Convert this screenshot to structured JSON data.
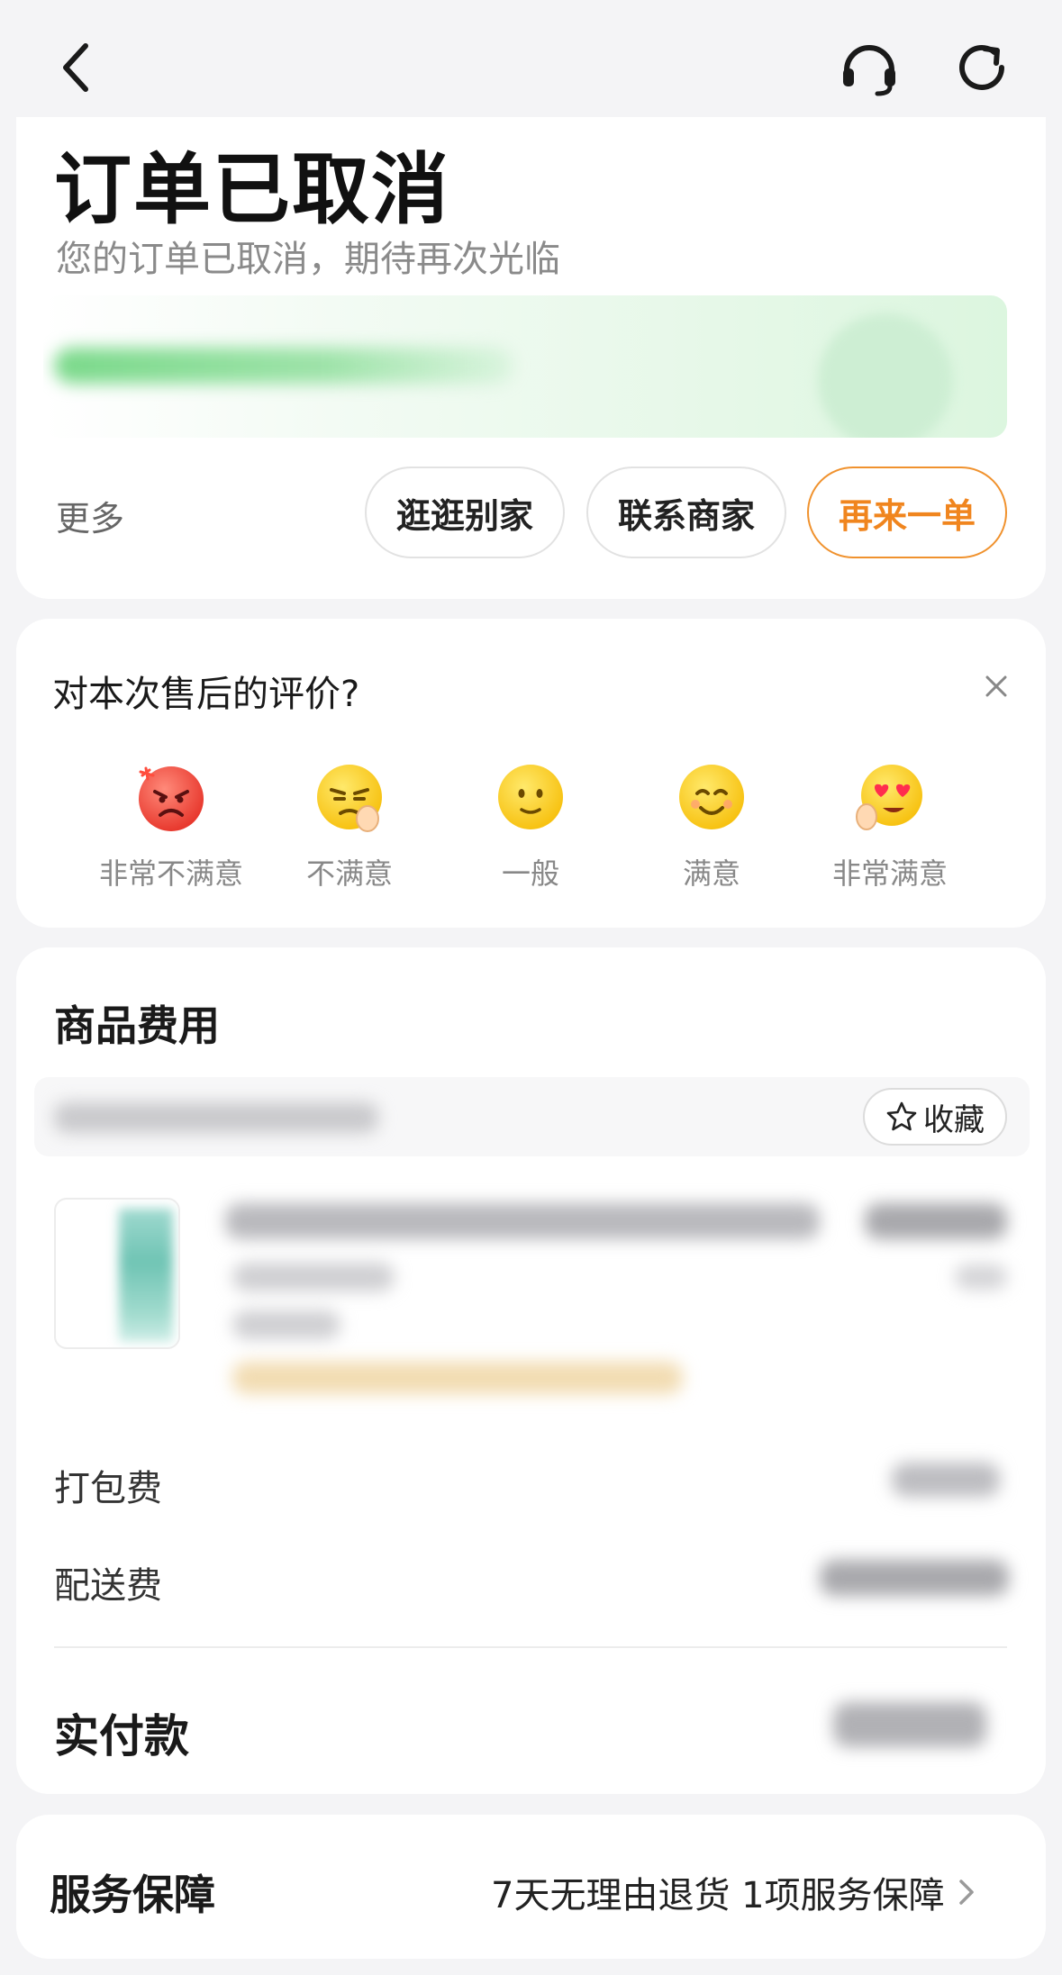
{
  "header": {
    "back_icon": "chevron-left-icon",
    "service_icon": "headset-icon",
    "refresh_icon": "refresh-icon"
  },
  "status": {
    "title": "订单已取消",
    "subtitle": "您的订单已取消，期待再次光临",
    "more_label": "更多",
    "actions": {
      "browse_other": "逛逛别家",
      "contact_merchant": "联系商家",
      "order_again": "再来一单"
    },
    "accent_color": "#f0851e"
  },
  "rating": {
    "question": "对本次售后的评价?",
    "options": [
      {
        "label": "非常不满意",
        "icon": "angry-face-icon"
      },
      {
        "label": "不满意",
        "icon": "displeased-face-icon"
      },
      {
        "label": "一般",
        "icon": "neutral-face-icon"
      },
      {
        "label": "满意",
        "icon": "smiling-face-icon"
      },
      {
        "label": "非常满意",
        "icon": "heart-eyes-face-icon"
      }
    ]
  },
  "fees": {
    "title": "商品费用",
    "favorite_label": "收藏",
    "packing_fee_label": "打包费",
    "delivery_fee_label": "配送费",
    "paid_label": "实付款"
  },
  "guarantee": {
    "title": "服务保障",
    "detail": "7天无理由退货 1项服务保障"
  }
}
